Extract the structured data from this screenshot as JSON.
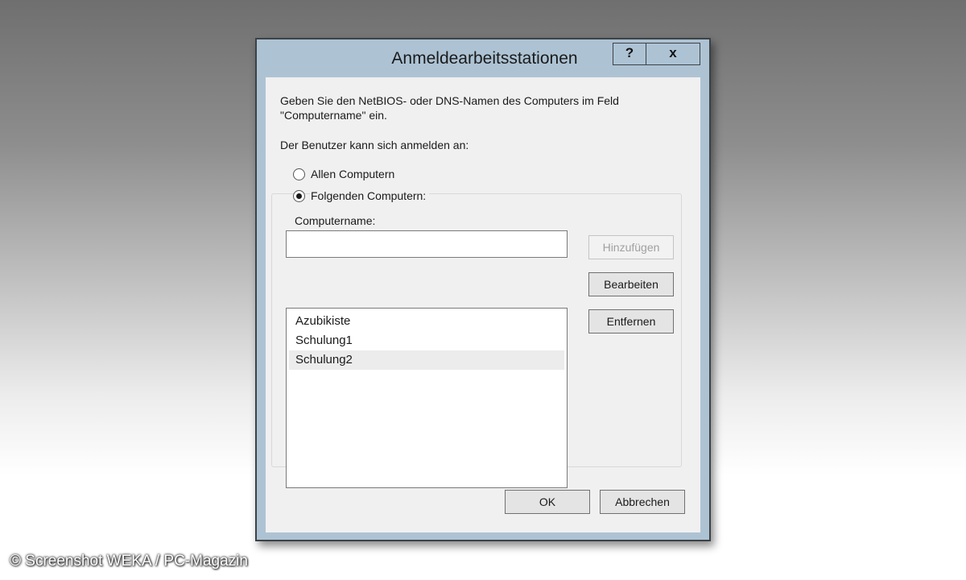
{
  "window": {
    "title": "Anmeldearbeitsstationen",
    "help_label": "?",
    "close_label": "x"
  },
  "instructions": {
    "line1": "Geben Sie den NetBIOS- oder DNS-Namen des Computers im Feld",
    "line2": "\"Computername\" ein."
  },
  "login_label": "Der Benutzer kann sich anmelden an:",
  "options": {
    "all": {
      "label": "Allen Computern",
      "checked": false
    },
    "following": {
      "label": "Folgenden Computern:",
      "checked": true
    }
  },
  "computername": {
    "label": "Computername:",
    "value": ""
  },
  "buttons": {
    "add": "Hinzufügen",
    "edit": "Bearbeiten",
    "remove": "Entfernen",
    "ok": "OK",
    "cancel": "Abbrechen"
  },
  "computers": [
    "Azubikiste",
    "Schulung1",
    "Schulung2"
  ],
  "selected_computer": "Schulung2",
  "watermark": "© Screenshot WEKA / PC-Magazin"
}
